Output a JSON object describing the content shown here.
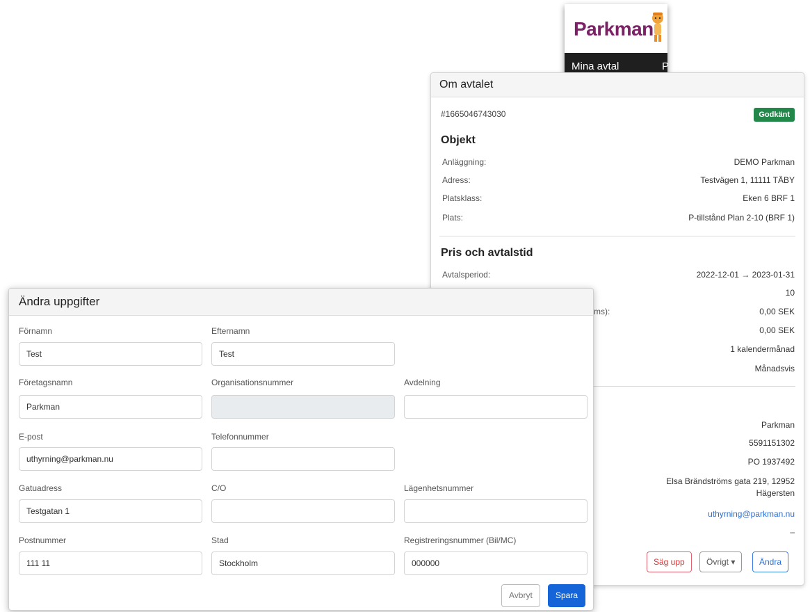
{
  "logo": {
    "brand": "Parkman",
    "nav_item": "Mina avtal",
    "nav_item_2": "P"
  },
  "contract": {
    "header": "Om avtalet",
    "id": "#1665046743030",
    "status_badge": "Godkänt",
    "object_title": "Objekt",
    "object_rows": [
      {
        "label": "Anläggning:",
        "value": "DEMO Parkman"
      },
      {
        "label": "Adress:",
        "value": "Testvägen 1, 11111 TÄBY"
      },
      {
        "label": "Platsklass:",
        "value": "Eken 6 BRF 1"
      },
      {
        "label": "Plats:",
        "value": "P-tillstånd Plan 2-10 (BRF 1)"
      }
    ],
    "price_title": "Pris och avtalstid",
    "price_rows": [
      {
        "label": "Avtalsperiod:",
        "value": "2022-12-01 → 2023-01-31"
      },
      {
        "label": "",
        "value": "10"
      },
      {
        "label": "ms):",
        "value": "0,00 SEK"
      },
      {
        "label": "",
        "value": "0,00 SEK"
      },
      {
        "label": "",
        "value": "1 kalendermånad"
      },
      {
        "label": "",
        "value": "Månadsvis"
      }
    ],
    "tenant_rows": [
      {
        "value": "Parkman"
      },
      {
        "value": "5591151302"
      },
      {
        "value": "PO 1937492"
      },
      {
        "value": "Elsa Brändströms gata 219, 12952"
      },
      {
        "value": "Hägersten"
      },
      {
        "value": "uthyrning@parkman.nu"
      },
      {
        "value": "–"
      }
    ],
    "buttons": {
      "cancel": "Säg upp",
      "other": "Övrigt ▾",
      "edit": "Ändra"
    }
  },
  "edit_form": {
    "title": "Ändra uppgifter",
    "fields": {
      "firstname": {
        "label": "Förnamn",
        "value": "Test"
      },
      "lastname": {
        "label": "Efternamn",
        "value": "Test"
      },
      "company": {
        "label": "Företagsnamn",
        "value": "Parkman"
      },
      "orgnr": {
        "label": "Organisationsnummer",
        "value": ""
      },
      "department": {
        "label": "Avdelning",
        "value": ""
      },
      "email": {
        "label": "E-post",
        "value": "uthyrning@parkman.nu"
      },
      "phone": {
        "label": "Telefonnummer",
        "value": ""
      },
      "street": {
        "label": "Gatuadress",
        "value": "Testgatan 1"
      },
      "co": {
        "label": "C/O",
        "value": ""
      },
      "apartment": {
        "label": "Lägenhetsnummer",
        "value": ""
      },
      "postal": {
        "label": "Postnummer",
        "value": "111 11"
      },
      "city": {
        "label": "Stad",
        "value": "Stockholm"
      },
      "regnr": {
        "label": "Registreringsnummer (Bil/MC)",
        "value": "000000"
      }
    },
    "buttons": {
      "abort": "Avbryt",
      "save": "Spara"
    }
  }
}
